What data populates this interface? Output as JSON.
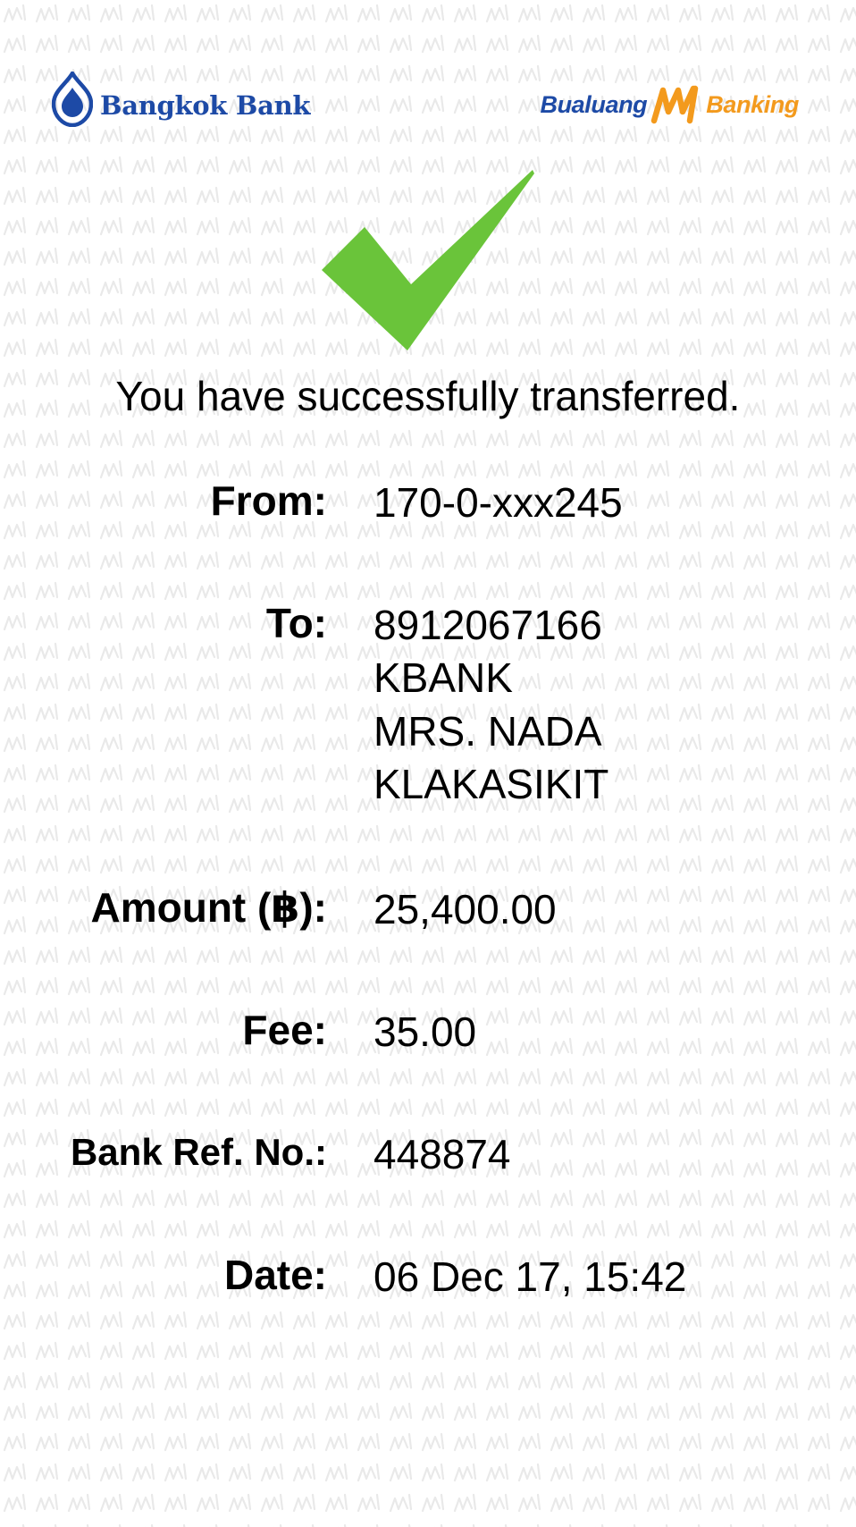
{
  "header": {
    "bank_logo_text": "Bangkok Bank",
    "app_logo_left": "Bualuang",
    "app_logo_right": "Banking"
  },
  "status": {
    "icon": "check-icon",
    "message": "You have successfully transferred."
  },
  "transfer": {
    "from": {
      "label": "From:",
      "value": "170-0-xxx245"
    },
    "to": {
      "label": "To:",
      "account": "8912067166",
      "bank": "KBANK",
      "name_line1": "MRS. NADA",
      "name_line2": "KLAKASIKIT"
    },
    "amount": {
      "label": "Amount (฿):",
      "value": "25,400.00"
    },
    "fee": {
      "label": "Fee:",
      "value": "35.00"
    },
    "ref": {
      "label": "Bank Ref. No.:",
      "value": "448874"
    },
    "date": {
      "label": "Date:",
      "value": "06 Dec 17, 15:42"
    }
  },
  "colors": {
    "brand_blue": "#1d4aa6",
    "brand_orange": "#f39a1d",
    "success_green": "#6ac43a",
    "watermark": "#ececec"
  }
}
